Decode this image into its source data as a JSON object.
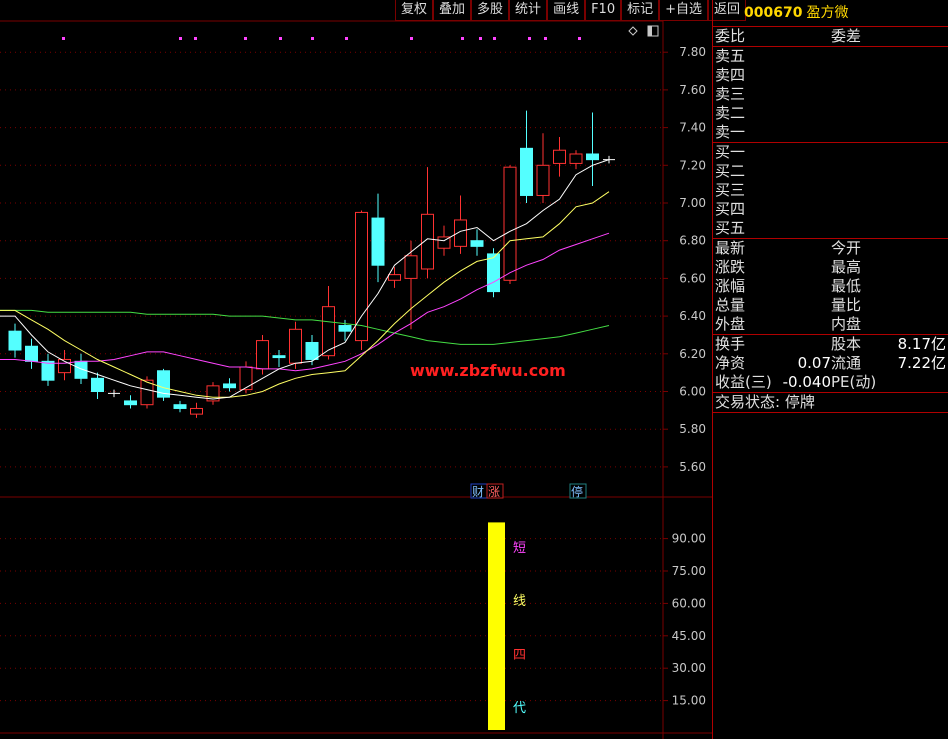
{
  "toolbar": {
    "buttons": [
      "复权",
      "叠加",
      "多股",
      "统计",
      "画线",
      "F10",
      "标记",
      "+自选",
      "返回"
    ]
  },
  "stock": {
    "code": "000670",
    "name": "盈方微"
  },
  "quote": {
    "weibi_label": "委比",
    "weicha_label": "委差",
    "sell_labels": [
      "卖五",
      "卖四",
      "卖三",
      "卖二",
      "卖一"
    ],
    "buy_labels": [
      "买一",
      "买二",
      "买三",
      "买四",
      "买五"
    ],
    "stats": [
      {
        "l1": "最新",
        "l2": "今开"
      },
      {
        "l1": "涨跌",
        "l2": "最高"
      },
      {
        "l1": "涨幅",
        "l2": "最低"
      },
      {
        "l1": "总量",
        "l2": "量比"
      },
      {
        "l1": "外盘",
        "l2": "内盘"
      }
    ],
    "fund": [
      {
        "l1": "换手",
        "v1": "",
        "l2": "股本",
        "v2": "8.17亿"
      },
      {
        "l1": "净资",
        "v1": "0.07",
        "l2": "流通",
        "v2": "7.22亿"
      },
      {
        "l1": "收益(三)",
        "v1": "-0.040",
        "l2": "PE(动)",
        "v2": ""
      }
    ],
    "status": "交易状态: 停牌"
  },
  "watermark": "www.zbzfwu.com",
  "event_markers": [
    "财",
    "涨",
    "停"
  ],
  "colors": {
    "up": "#ff3232",
    "down": "#54ffff",
    "ma5": "#ffffff",
    "ma10": "#ffff64",
    "ma20": "#ff44ff",
    "ma60": "#44dd44",
    "grid": "#7a0000",
    "axis_text": "#c8c8c8",
    "bar": "#ffff00"
  },
  "chart_data": [
    {
      "type": "candlestick",
      "ylim": [
        5.5,
        7.95
      ],
      "yticks": [
        "7.80",
        "7.60",
        "7.40",
        "7.20",
        "7.00",
        "6.80",
        "6.60",
        "6.40",
        "6.20",
        "6.00",
        "5.80",
        "5.60"
      ],
      "candles": [
        {
          "o": 6.32,
          "c": 6.22,
          "h": 6.36,
          "l": 6.18
        },
        {
          "o": 6.24,
          "c": 6.16,
          "h": 6.28,
          "l": 6.12
        },
        {
          "o": 6.16,
          "c": 6.06,
          "h": 6.2,
          "l": 6.03
        },
        {
          "o": 6.1,
          "c": 6.17,
          "h": 6.22,
          "l": 6.06
        },
        {
          "o": 6.16,
          "c": 6.07,
          "h": 6.2,
          "l": 6.04
        },
        {
          "o": 6.07,
          "c": 6.0,
          "h": 6.1,
          "l": 5.96
        },
        {
          "o": 5.99,
          "c": 5.99,
          "h": 6.01,
          "l": 5.97
        },
        {
          "o": 5.95,
          "c": 5.93,
          "h": 5.98,
          "l": 5.91
        },
        {
          "o": 5.93,
          "c": 6.06,
          "h": 6.08,
          "l": 5.91
        },
        {
          "o": 6.11,
          "c": 5.97,
          "h": 6.12,
          "l": 5.95
        },
        {
          "o": 5.93,
          "c": 5.91,
          "h": 5.95,
          "l": 5.89
        },
        {
          "o": 5.88,
          "c": 5.91,
          "h": 5.94,
          "l": 5.86
        },
        {
          "o": 5.95,
          "c": 6.03,
          "h": 6.05,
          "l": 5.93
        },
        {
          "o": 6.04,
          "c": 6.02,
          "h": 6.07,
          "l": 6.0
        },
        {
          "o": 6.01,
          "c": 6.13,
          "h": 6.16,
          "l": 5.99
        },
        {
          "o": 6.12,
          "c": 6.27,
          "h": 6.3,
          "l": 6.09
        },
        {
          "o": 6.19,
          "c": 6.18,
          "h": 6.22,
          "l": 6.13
        },
        {
          "o": 6.15,
          "c": 6.33,
          "h": 6.37,
          "l": 6.12
        },
        {
          "o": 6.26,
          "c": 6.17,
          "h": 6.3,
          "l": 6.14
        },
        {
          "o": 6.19,
          "c": 6.45,
          "h": 6.56,
          "l": 6.17
        },
        {
          "o": 6.35,
          "c": 6.32,
          "h": 6.38,
          "l": 6.27
        },
        {
          "o": 6.27,
          "c": 6.95,
          "h": 6.96,
          "l": 6.22
        },
        {
          "o": 6.92,
          "c": 6.67,
          "h": 7.05,
          "l": 6.58
        },
        {
          "o": 6.59,
          "c": 6.62,
          "h": 6.66,
          "l": 6.55
        },
        {
          "o": 6.6,
          "c": 6.72,
          "h": 6.8,
          "l": 6.33
        },
        {
          "o": 6.65,
          "c": 6.94,
          "h": 7.19,
          "l": 6.6
        },
        {
          "o": 6.76,
          "c": 6.82,
          "h": 6.88,
          "l": 6.72
        },
        {
          "o": 6.77,
          "c": 6.91,
          "h": 7.04,
          "l": 6.73
        },
        {
          "o": 6.8,
          "c": 6.77,
          "h": 6.86,
          "l": 6.72
        },
        {
          "o": 6.73,
          "c": 6.53,
          "h": 6.76,
          "l": 6.5
        },
        {
          "o": 6.59,
          "c": 7.19,
          "h": 7.2,
          "l": 6.57
        },
        {
          "o": 7.29,
          "c": 7.04,
          "h": 7.49,
          "l": 7.0
        },
        {
          "o": 7.04,
          "c": 7.2,
          "h": 7.37,
          "l": 7.0
        },
        {
          "o": 7.21,
          "c": 7.28,
          "h": 7.35,
          "l": 7.14
        },
        {
          "o": 7.21,
          "c": 7.26,
          "h": 7.28,
          "l": 7.18
        },
        {
          "o": 7.26,
          "c": 7.23,
          "h": 7.48,
          "l": 7.09
        },
        {
          "o": 7.23,
          "c": 7.23,
          "h": 7.25,
          "l": 7.21
        }
      ],
      "ma5": [
        6.4,
        6.3,
        6.21,
        6.16,
        6.12,
        6.09,
        6.06,
        6.03,
        6.01,
        5.99,
        5.98,
        5.97,
        5.96,
        5.97,
        6.02,
        6.07,
        6.12,
        6.15,
        6.16,
        6.22,
        6.26,
        6.4,
        6.52,
        6.67,
        6.74,
        6.81,
        6.8,
        6.85,
        6.87,
        6.8,
        6.85,
        6.89,
        6.96,
        7.02,
        7.15,
        7.2,
        7.23
      ],
      "ma10": [
        6.43,
        6.38,
        6.33,
        6.27,
        6.22,
        6.17,
        6.13,
        6.09,
        6.05,
        6.02,
        6.0,
        5.98,
        5.97,
        5.97,
        5.98,
        6.0,
        6.04,
        6.07,
        6.09,
        6.1,
        6.11,
        6.19,
        6.27,
        6.36,
        6.44,
        6.51,
        6.58,
        6.64,
        6.69,
        6.71,
        6.8,
        6.81,
        6.82,
        6.89,
        6.98,
        7.0,
        7.06
      ],
      "ma20": [
        6.17,
        6.16,
        6.15,
        6.15,
        6.16,
        6.16,
        6.17,
        6.19,
        6.21,
        6.21,
        6.19,
        6.17,
        6.15,
        6.13,
        6.13,
        6.12,
        6.12,
        6.11,
        6.12,
        6.14,
        6.16,
        6.2,
        6.25,
        6.31,
        6.36,
        6.42,
        6.45,
        6.49,
        6.54,
        6.58,
        6.63,
        6.67,
        6.7,
        6.75,
        6.78,
        6.81,
        6.84
      ],
      "ma60": [
        6.43,
        6.43,
        6.42,
        6.42,
        6.42,
        6.42,
        6.42,
        6.42,
        6.41,
        6.41,
        6.41,
        6.41,
        6.41,
        6.4,
        6.4,
        6.4,
        6.39,
        6.38,
        6.38,
        6.37,
        6.36,
        6.35,
        6.33,
        6.31,
        6.29,
        6.27,
        6.26,
        6.25,
        6.25,
        6.25,
        6.26,
        6.27,
        6.28,
        6.29,
        6.31,
        6.33,
        6.35
      ]
    },
    {
      "type": "bar",
      "series": [
        {
          "name": "短线四代",
          "values": [
            100
          ]
        }
      ],
      "ylim": [
        0,
        100
      ],
      "yticks": [
        "90.00",
        "75.00",
        "60.00",
        "45.00",
        "30.00",
        "15.00"
      ],
      "labels": [
        "短",
        "线",
        "四",
        "代"
      ]
    }
  ]
}
